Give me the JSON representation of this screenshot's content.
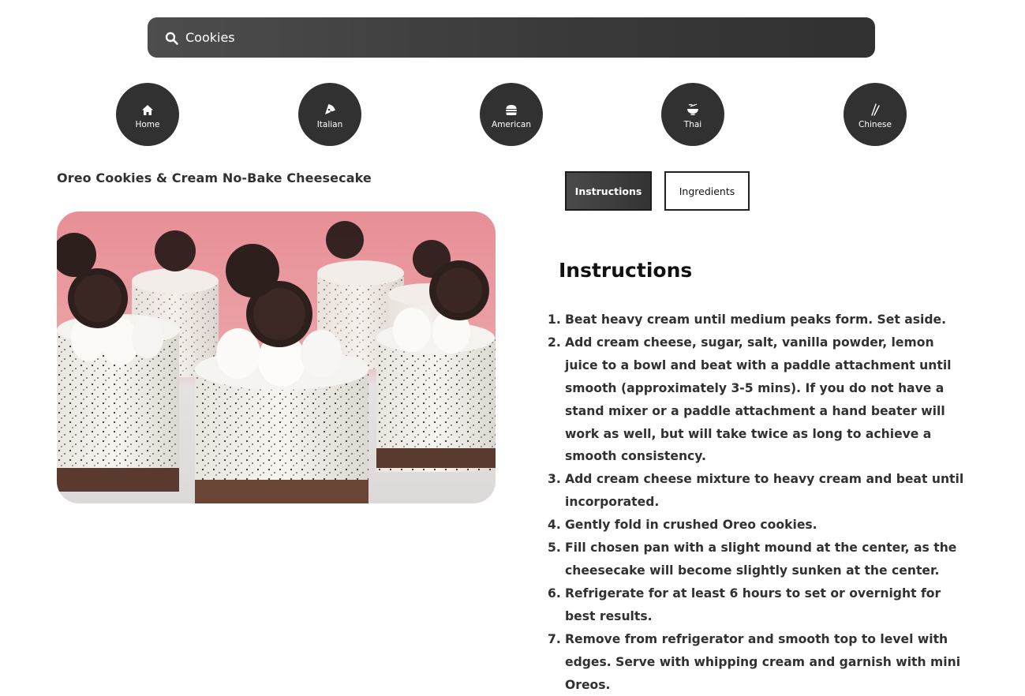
{
  "search": {
    "value": "Cookies",
    "placeholder": ""
  },
  "nav": [
    {
      "label": "Home",
      "icon": "home-icon"
    },
    {
      "label": "Italian",
      "icon": "pizza-icon"
    },
    {
      "label": "American",
      "icon": "burger-icon"
    },
    {
      "label": "Thai",
      "icon": "noodle-bowl-icon"
    },
    {
      "label": "Chinese",
      "icon": "chopsticks-icon"
    }
  ],
  "recipe": {
    "title": "Oreo Cookies & Cream No-Bake Cheesecake"
  },
  "tabs": {
    "instructions": "Instructions",
    "ingredients": "Ingredients",
    "active": "Instructions"
  },
  "section": {
    "heading": "Instructions"
  },
  "steps": [
    {
      "num": "1.",
      "text": "Beat heavy cream until medium peaks form. Set aside."
    },
    {
      "num": "2.",
      "text": "Add cream cheese, sugar, salt, vanilla powder, lemon juice to a bowl and beat with a paddle attachment until smooth (approximately 3-5 mins). If you do not have a stand mixer or a paddle attachment a hand beater will work as well, but will take twice as long to achieve a smooth consistency."
    },
    {
      "num": "3.",
      "text": "Add cream cheese mixture to heavy cream and beat until incorporated."
    },
    {
      "num": "4.",
      "text": "Gently fold in crushed Oreo cookies."
    },
    {
      "num": "5.",
      "text": "Fill chosen pan with a slight mound at the center, as the cheesecake will become slightly sunken at the center."
    },
    {
      "num": "6.",
      "text": "Refrigerate for at least 6 hours to set or overnight for best results."
    },
    {
      "num": "7.",
      "text": "Remove from refrigerator and smooth top to level with edges. Serve with whipping cream and garnish with mini Oreos."
    }
  ],
  "colors": {
    "dark": "#313131",
    "accent_pink": "#e89aa0"
  }
}
